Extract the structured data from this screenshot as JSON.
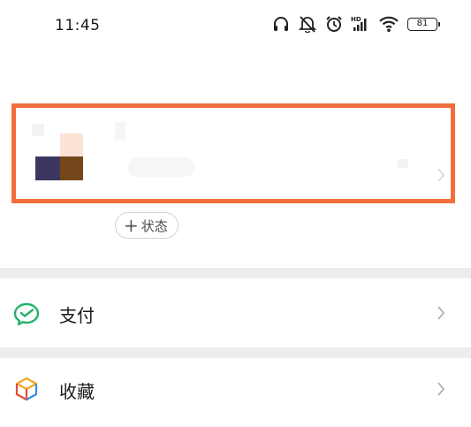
{
  "status_bar": {
    "time": "11:45",
    "battery": "81",
    "icons": [
      "headphones-icon",
      "mute-icon",
      "alarm-icon",
      "hd-signal-icon",
      "wifi-icon",
      "battery-icon"
    ]
  },
  "profile": {
    "status_button_label": "状态",
    "status_button_icon": "plus-icon",
    "highlight_color": "#f26f3d"
  },
  "menu": {
    "items": [
      {
        "label": "支付",
        "icon": "wechat-pay-icon"
      },
      {
        "label": "收藏",
        "icon": "favorites-cube-icon"
      }
    ]
  }
}
